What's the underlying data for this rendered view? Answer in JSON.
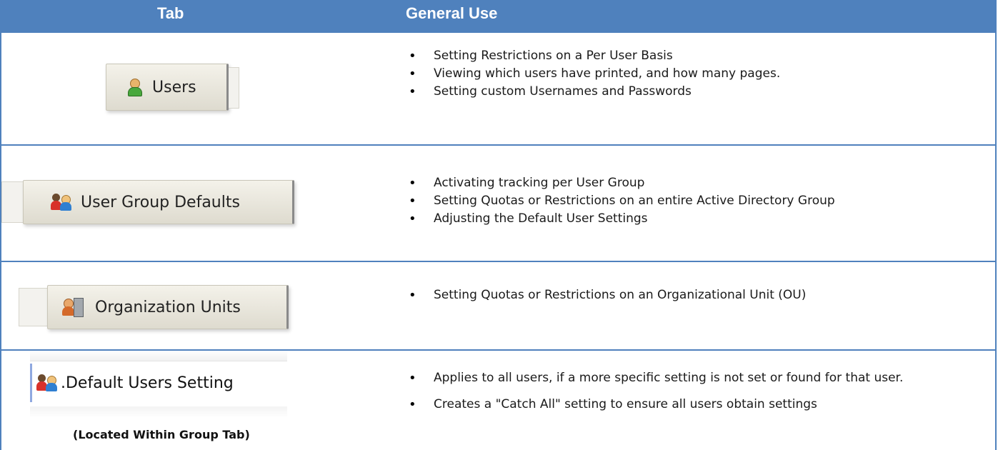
{
  "header": {
    "col_tab": "Tab",
    "col_use": "General Use",
    "color": "#4f81bd"
  },
  "rows": [
    {
      "tab_label": "Users",
      "icon": "user-icon",
      "items": [
        "Setting Restrictions on a Per User Basis",
        "Viewing which users have printed, and how many pages.",
        "Setting custom Usernames and Passwords"
      ]
    },
    {
      "tab_label": "User Group Defaults",
      "icon": "user-group-icon",
      "items": [
        "Activating tracking per User Group",
        "Setting Quotas or Restrictions on an entire Active Directory Group",
        "Adjusting the Default User Settings"
      ]
    },
    {
      "tab_label": "Organization Units",
      "icon": "organization-unit-icon",
      "items": [
        "Setting Quotas or Restrictions on an Organizational Unit (OU)"
      ]
    },
    {
      "tab_label": ".Default Users Setting",
      "icon": "user-group-icon",
      "caption": "(Located Within Group Tab)",
      "items": [
        "Applies to all users, if a more specific setting is not set or found for that user.",
        "Creates a \"Catch All\" setting to ensure all users obtain settings"
      ]
    }
  ]
}
